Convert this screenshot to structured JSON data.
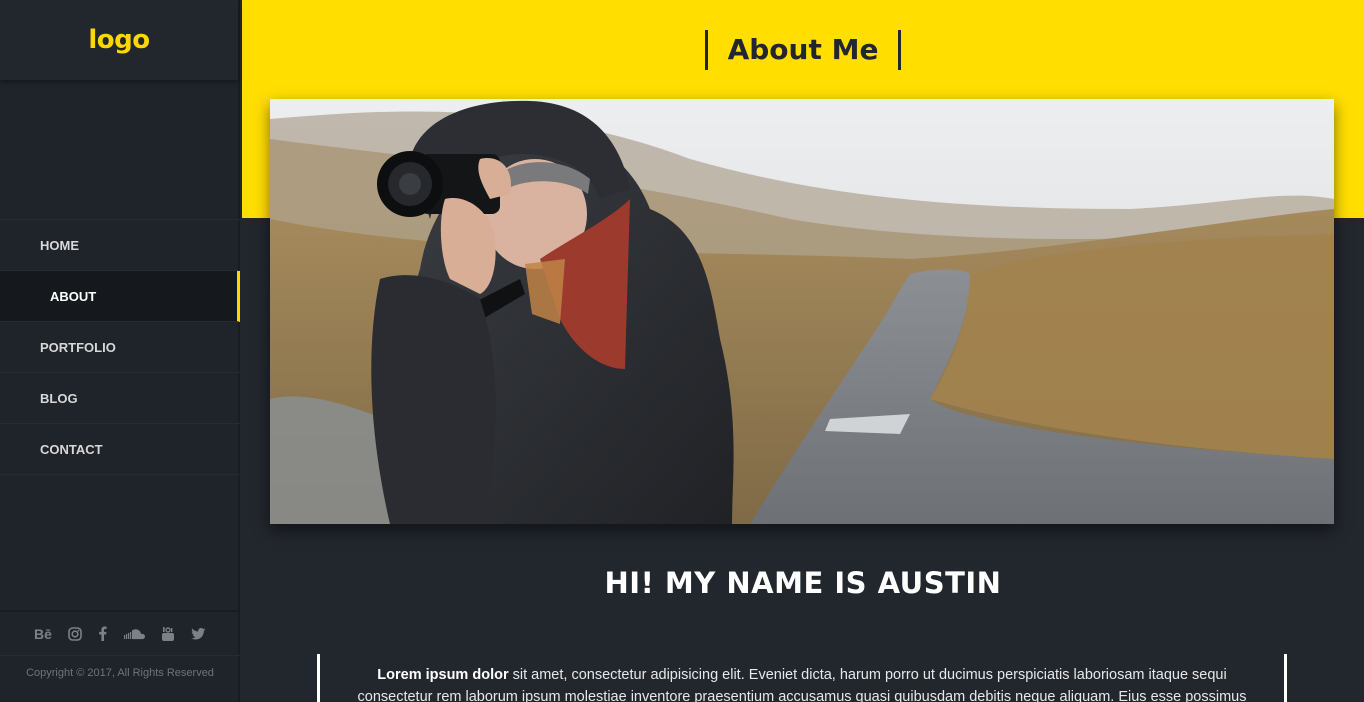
{
  "sidebar": {
    "logo": "logo",
    "nav": [
      {
        "label": "HOME",
        "active": false
      },
      {
        "label": "ABOUT",
        "active": true
      },
      {
        "label": "PORTFOLIO",
        "active": false
      },
      {
        "label": "BLOG",
        "active": false
      },
      {
        "label": "CONTACT",
        "active": false
      }
    ],
    "social": [
      "behance-icon",
      "instagram-icon",
      "facebook-icon",
      "soundcloud-icon",
      "youtube-icon",
      "twitter-icon"
    ],
    "behance_text": "Bē",
    "copyright": "Copyright © 2017, All Rights Reserved"
  },
  "header": {
    "title": "About Me",
    "accent_color": "#ffde00"
  },
  "content": {
    "heading": "HI! MY NAME IS AUSTIN",
    "bio_bold": "Lorem ipsum dolor",
    "bio_rest": " sit amet, consectetur adipisicing elit. Eveniet dicta, harum porro ut ducimus perspiciatis laboriosam itaque sequi consectetur rem laborum ipsum molestiae inventore praesentium accusamus quasi quibusdam debitis neque aliquam. Eius esse possimus"
  }
}
